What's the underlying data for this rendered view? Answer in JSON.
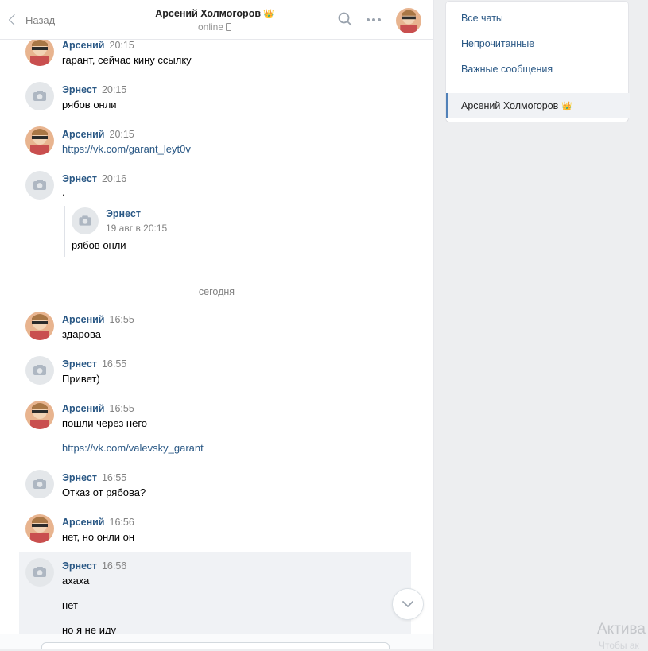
{
  "header": {
    "back_label": "Назад",
    "peer_name": "Арсений Холмогоров",
    "peer_badge": "👑",
    "peer_status": "online",
    "icons": [
      "search-icon",
      "more-icon",
      "avatar"
    ]
  },
  "messages": [
    {
      "author": "Арсений",
      "time": "20:15",
      "text": "гарант, сейчас кину ссылку"
    },
    {
      "author": "Эрнест",
      "time": "20:15",
      "text": "рябов онли"
    },
    {
      "author": "Арсений",
      "time": "20:15",
      "text": "https://vk.com/garant_leyt0v"
    },
    {
      "author": "Эрнест",
      "time": "20:16",
      "text": "."
    },
    {
      "author": "Арсений",
      "time": "16:55",
      "text": "здарова"
    },
    {
      "author": "Эрнест",
      "time": "16:55",
      "text": "Привет)"
    },
    {
      "author": "Арсений",
      "time": "16:55",
      "text": "пошли через него",
      "text2": "https://vk.com/valevsky_garant"
    },
    {
      "author": "Эрнест",
      "time": "16:55",
      "text": "Отказ от рябова?"
    },
    {
      "author": "Арсений",
      "time": "16:56",
      "text": "нет, но онли он"
    },
    {
      "author": "Эрнест",
      "time": "16:56",
      "text": "ахаха",
      "text2": "нет",
      "text3": "но я не иду"
    }
  ],
  "forwarded": {
    "author": "Эрнест",
    "date": "19 авг в 20:15",
    "text": "рябов онли"
  },
  "date_separator": "сегодня",
  "right_menu": {
    "items": [
      "Все чаты",
      "Непрочитанные",
      "Важные сообщения"
    ],
    "active_chat": "Арсений Холмогоров",
    "active_chat_badge": "👑"
  },
  "watermark": {
    "title": "Актива",
    "subtitle": "Чтобы ак"
  },
  "colors": {
    "link": "#2a5885",
    "accent": "#5181b8",
    "background": "#edeef0"
  }
}
